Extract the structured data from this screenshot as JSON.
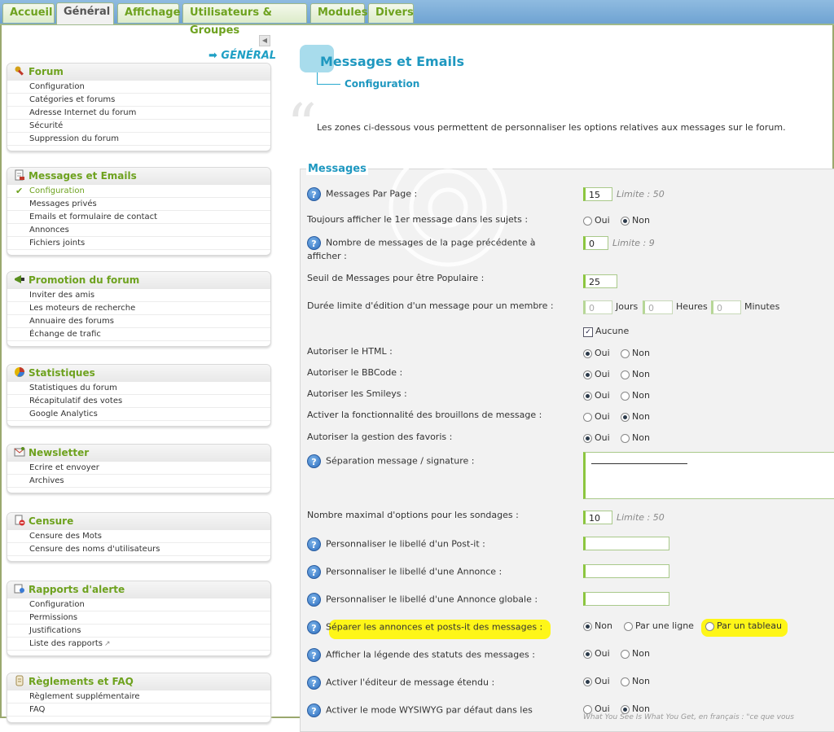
{
  "tabs": [
    "Accueil",
    "Général",
    "Affichage",
    "Utilisateurs & Groupes",
    "Modules",
    "Divers"
  ],
  "active_tab": "Général",
  "sidebar": {
    "section_title": "➡ GÉNÉRAL",
    "groups": [
      {
        "title": "Forum",
        "icon": "wrench-icon",
        "items": [
          "Configuration",
          "Catégories et forums",
          "Adresse Internet du forum",
          "Sécurité",
          "Suppression du forum"
        ]
      },
      {
        "title": "Messages et Emails",
        "icon": "document-icon",
        "items": [
          "Configuration",
          "Messages privés",
          "Emails et formulaire de contact",
          "Annonces",
          "Fichiers joints"
        ],
        "active_item": "Configuration"
      },
      {
        "title": "Promotion du forum",
        "icon": "megaphone-icon",
        "items": [
          "Inviter des amis",
          "Les moteurs de recherche",
          "Annuaire des forums",
          "Échange de trafic"
        ]
      },
      {
        "title": "Statistiques",
        "icon": "pie-chart-icon",
        "items": [
          "Statistiques du forum",
          "Récapitulatif des votes",
          "Google Analytics"
        ]
      },
      {
        "title": "Newsletter",
        "icon": "newsletter-icon",
        "items": [
          "Ecrire et envoyer",
          "Archives"
        ]
      },
      {
        "title": "Censure",
        "icon": "censor-icon",
        "items": [
          "Censure des Mots",
          "Censure des noms d'utilisateurs"
        ]
      },
      {
        "title": "Rapports d'alerte",
        "icon": "report-icon",
        "items": [
          "Configuration",
          "Permissions",
          "Justifications",
          "Liste des rapports"
        ]
      },
      {
        "title": "Règlements et FAQ",
        "icon": "scroll-icon",
        "items": [
          "Règlement supplémentaire",
          "FAQ"
        ]
      }
    ]
  },
  "header": {
    "title": "Messages et Emails",
    "subtitle": "Configuration",
    "intro": "Les zones ci-dessous vous permettent de personnaliser les options relatives aux messages sur le forum."
  },
  "panel": {
    "legend": "Messages",
    "labels": {
      "messages_par_page": "Messages Par Page :",
      "toujours_1er": "Toujours afficher le 1er message dans les sujets :",
      "nb_precedente": "Nombre de messages de la page précédente à afficher :",
      "seuil_populaire": "Seuil de Messages pour être Populaire :",
      "duree_edition": "Durée limite d'édition d'un message pour un membre :",
      "autoriser_html": "Autoriser le HTML :",
      "autoriser_bbcode": "Autoriser le BBCode :",
      "autoriser_smileys": "Autoriser les Smileys :",
      "brouillons": "Activer la fonctionnalité des brouillons de message :",
      "favoris": "Autoriser la gestion des favoris :",
      "separation_signature": "Séparation message / signature :",
      "nb_options_sondages": "Nombre maximal d'options pour les sondages :",
      "libelle_postit": "Personnaliser le libellé d'un Post-it :",
      "libelle_annonce": "Personnaliser le libellé d'une Annonce :",
      "libelle_annonce_globale": "Personnaliser le libellé d'une Annonce globale :",
      "separer_annonces": "Séparer les annonces et posts-it des messages :",
      "legende_statuts": "Afficher la légende des statuts des messages :",
      "editeur_etendu": "Activer l'éditeur de message étendu :",
      "wysiwyg": "Activer le mode WYSIWYG par défaut dans les"
    },
    "values": {
      "messages_par_page": "15",
      "nb_precedente": "0",
      "seuil_populaire": "25",
      "jours": "0",
      "heures": "0",
      "minutes": "0",
      "nb_options_sondages": "10"
    },
    "notes": {
      "limite_50": "Limite : 50",
      "limite_9": "Limite : 9",
      "wysiwyg_help": "What You See Is What You Get, en français : \"ce que vous"
    },
    "units": {
      "jours": "Jours",
      "heures": "Heures",
      "minutes": "Minutes"
    },
    "options": {
      "oui": "Oui",
      "non": "Non",
      "aucune": "Aucune",
      "par_une_ligne": "Par une ligne",
      "par_un_tableau": "Par un tableau"
    },
    "help_icon": "?"
  },
  "colors": {
    "accent_green": "#6ea21f",
    "title_blue": "#1f98c0",
    "highlight": "#fff600"
  }
}
